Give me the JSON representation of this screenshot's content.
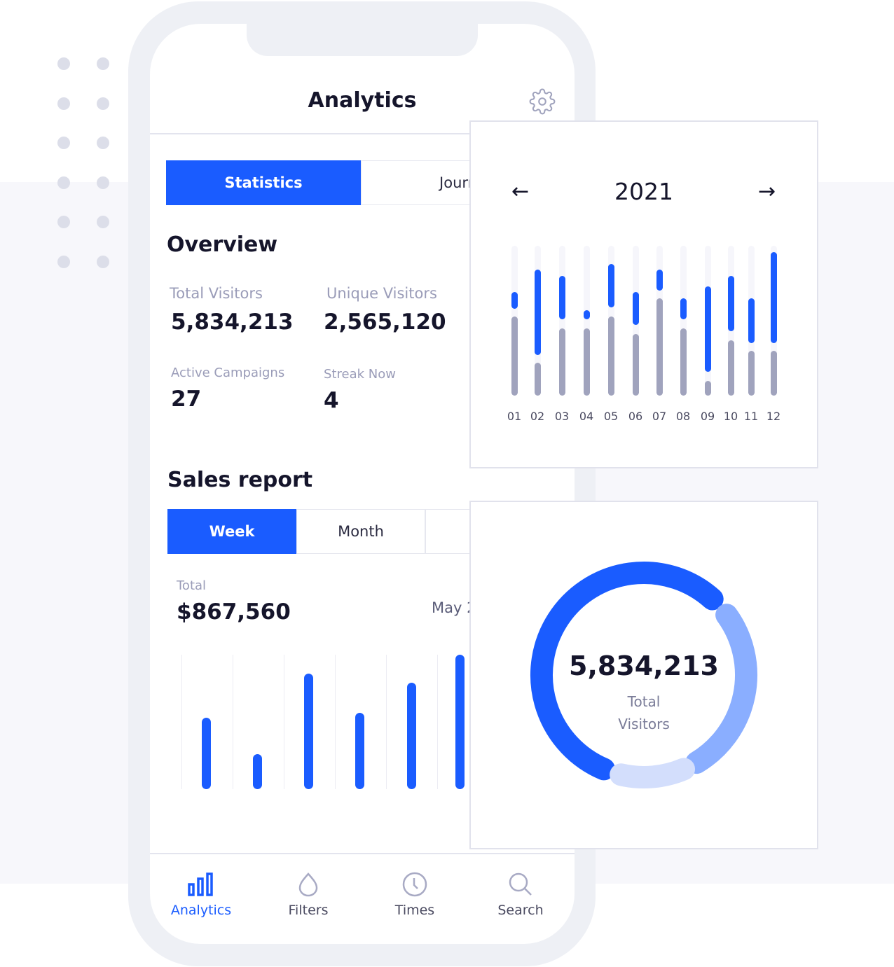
{
  "app": {
    "title": "Analytics",
    "settings_icon": "gear-icon"
  },
  "tabs": [
    {
      "label": "Statistics",
      "active": true
    },
    {
      "label": "Journ",
      "active": false
    }
  ],
  "overview": {
    "title": "Overview",
    "stats": [
      {
        "label": "Total Visitors",
        "value": "5,834,213"
      },
      {
        "label": "Unique Visitors",
        "value": "2,565,120"
      },
      {
        "label": "Active Campaigns",
        "value": "27"
      },
      {
        "label": "Streak Now",
        "value": "4"
      }
    ]
  },
  "sales": {
    "title": "Sales report",
    "periods": [
      {
        "label": "Week",
        "active": true
      },
      {
        "label": "Month",
        "active": false
      },
      {
        "label": "",
        "active": false
      }
    ],
    "total_label": "Total",
    "total_value": "$867,560",
    "date": "May 2",
    "bars": [
      0.53,
      0.26,
      0.86,
      0.57,
      0.79,
      1.0
    ]
  },
  "nav": [
    {
      "label": "Analytics",
      "icon": "bar-chart-icon",
      "active": true
    },
    {
      "label": "Filters",
      "icon": "drop-icon",
      "active": false
    },
    {
      "label": "Times",
      "icon": "clock-icon",
      "active": false
    },
    {
      "label": "Search",
      "icon": "search-icon",
      "active": false
    }
  ],
  "year_card": {
    "year": "2021",
    "prev_icon": "arrow-left-icon",
    "next_icon": "arrow-right-icon",
    "months": [
      "01",
      "02",
      "03",
      "04",
      "05",
      "06",
      "07",
      "08",
      "09",
      "10",
      "11",
      "12"
    ],
    "gray": [
      53,
      22,
      45,
      45,
      53,
      41,
      65,
      45,
      10,
      37,
      30,
      30
    ],
    "blue": [
      [
        58,
        69
      ],
      [
        27,
        84
      ],
      [
        51,
        80
      ],
      [
        51,
        57
      ],
      [
        59,
        88
      ],
      [
        47,
        69
      ],
      [
        70,
        84
      ],
      [
        51,
        65
      ],
      [
        16,
        73
      ],
      [
        43,
        80
      ],
      [
        35,
        65
      ],
      [
        35,
        96
      ]
    ]
  },
  "donut": {
    "value": "5,834,213",
    "label_line1": "Total",
    "label_line2": "Visitors",
    "segments": [
      {
        "from_deg": 203,
        "to_deg": 402,
        "color": "#1a5cff"
      },
      {
        "from_deg": 54,
        "to_deg": 149,
        "color": "#8aaeff"
      },
      {
        "from_deg": 157,
        "to_deg": 193,
        "color": "#d3defc"
      }
    ]
  },
  "colors": {
    "accent": "#1a5cff",
    "muted": "#a0a3bd"
  }
}
